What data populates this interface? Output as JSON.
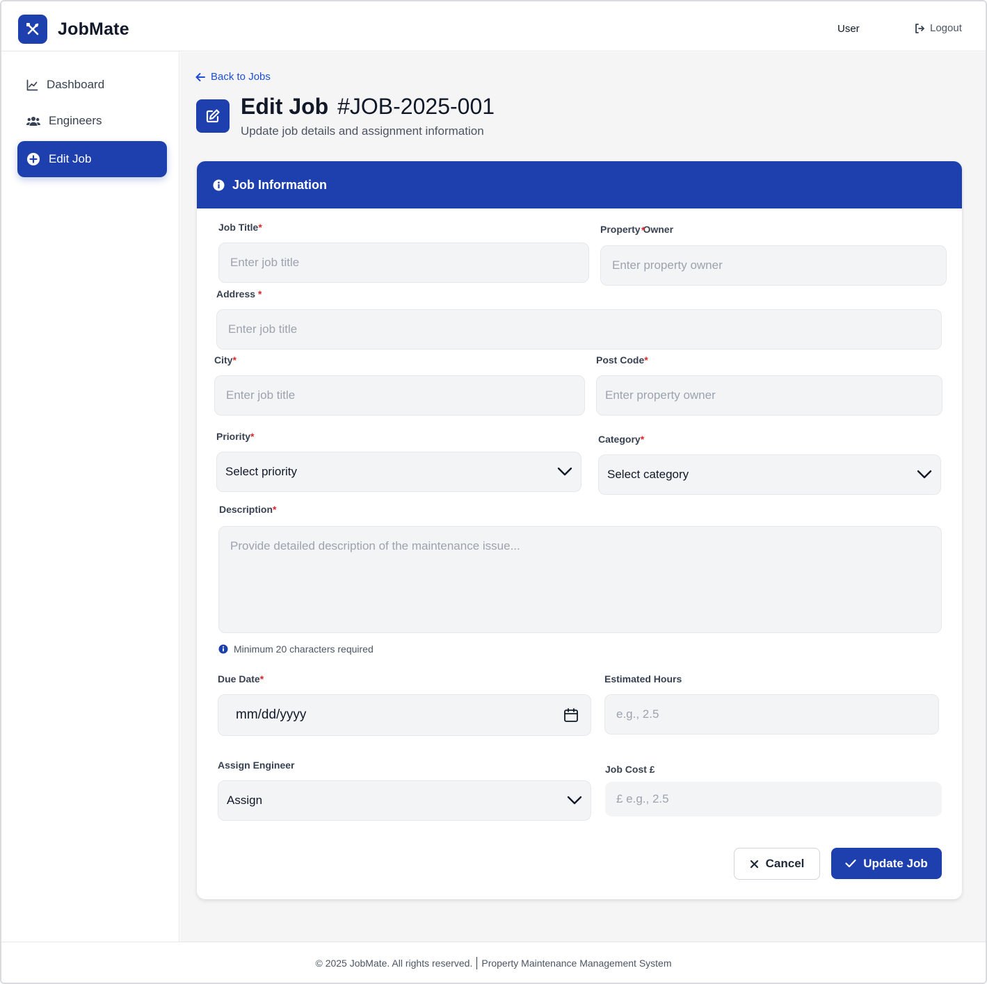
{
  "app": {
    "name": "JobMate"
  },
  "header": {
    "user_label": "User",
    "logout_label": "Logout"
  },
  "sidebar": {
    "items": [
      {
        "label": "Dashboard",
        "icon": "chart-line-icon",
        "active": false
      },
      {
        "label": "Engineers",
        "icon": "users-icon",
        "active": false
      },
      {
        "label": "Edit Job",
        "icon": "plus-circle-icon",
        "active": true
      }
    ]
  },
  "page": {
    "back_label": "Back to Jobs",
    "title": "Edit Job",
    "job_code": "#JOB-2025-001",
    "subtitle": "Update job details and assignment information"
  },
  "form": {
    "section_title": "Job Information",
    "required_marker": "*",
    "job_title": {
      "label": "Job Title",
      "placeholder": "Enter job title",
      "value": ""
    },
    "property_owner": {
      "label": "Property Owner",
      "placeholder": "Enter property owner",
      "value": ""
    },
    "address": {
      "label": "Address",
      "placeholder": "Enter job title",
      "value": ""
    },
    "city": {
      "label": "City",
      "placeholder": "Enter job title",
      "value": ""
    },
    "post_code": {
      "label": "Post Code",
      "placeholder": "Enter property owner",
      "value": ""
    },
    "priority": {
      "label": "Priority",
      "value": "Select priority"
    },
    "category": {
      "label": "Category",
      "value": "Select category"
    },
    "description": {
      "label": "Description",
      "placeholder": "Provide detailed description of the maintenance issue...",
      "hint": "Minimum 20 characters required"
    },
    "due_date": {
      "label": "Due Date",
      "value": "mm/dd/yyyy"
    },
    "estimated_hours": {
      "label": "Estimated Hours",
      "placeholder": "e.g., 2.5"
    },
    "assign_engineer": {
      "label": "Assign Engineer",
      "value": "Assign"
    },
    "job_cost": {
      "label": "Job Cost £",
      "placeholder": "£ e.g., 2.5"
    },
    "cancel_label": "Cancel",
    "submit_label": "Update Job"
  },
  "footer": {
    "copyright": "© 2025 JobMate. All rights reserved.",
    "tagline": "Property Maintenance Management System"
  },
  "colors": {
    "primary": "#1e40af",
    "required": "#dc2626",
    "link": "#1d4ed8"
  }
}
